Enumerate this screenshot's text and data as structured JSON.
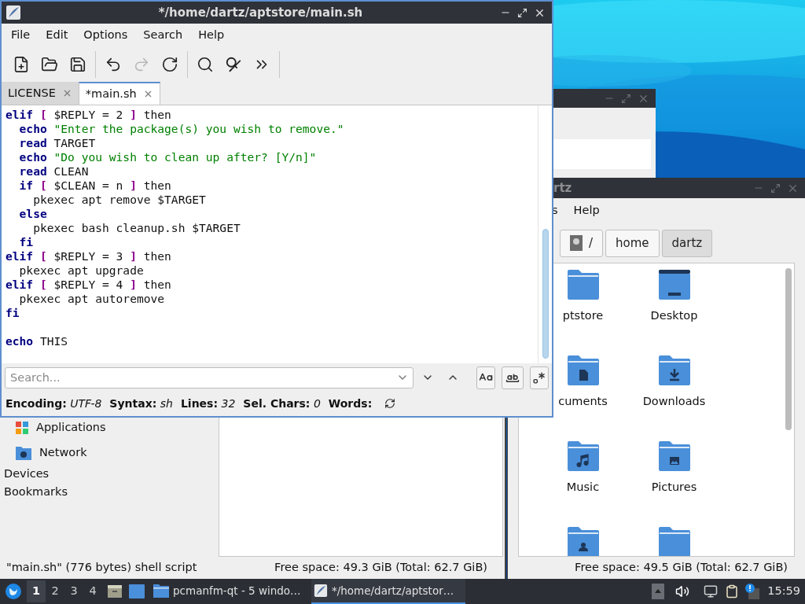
{
  "editor": {
    "title": "*/home/dartz/aptstore/main.sh",
    "menu": [
      "File",
      "Edit",
      "Options",
      "Search",
      "Help"
    ],
    "toolbar": [
      [
        {
          "disabled": false
        },
        {
          "disabled": false
        },
        {
          "disabled": false
        }
      ],
      [
        {
          "disabled": false
        },
        {
          "disabled": true
        },
        {
          "disabled": false
        }
      ],
      [
        {
          "disabled": false
        },
        {
          "disabled": false
        },
        {
          "disabled": false
        }
      ]
    ],
    "tabs": [
      {
        "label": "LICENSE",
        "selected": false
      },
      {
        "label": "*main.sh",
        "selected": true
      }
    ],
    "code": [
      [
        {
          "kind": "kw",
          "text": "elif"
        },
        {
          "kind": "br",
          "text": " ["
        },
        {
          "kind": "txt",
          "text": " $REPLY = 2 "
        },
        {
          "kind": "br",
          "text": "]"
        },
        {
          "kind": "txt",
          "text": " then"
        }
      ],
      [
        {
          "kind": "kw",
          "text": "  echo"
        },
        {
          "kind": "str",
          "text": " \"Enter the package(s) you wish to remove.\""
        }
      ],
      [
        {
          "kind": "kw",
          "text": "  read"
        },
        {
          "kind": "txt",
          "text": " TARGET"
        }
      ],
      [
        {
          "kind": "kw",
          "text": "  echo"
        },
        {
          "kind": "str",
          "text": " \"Do you wish to clean up after? [Y/n]\""
        }
      ],
      [
        {
          "kind": "kw",
          "text": "  read"
        },
        {
          "kind": "txt",
          "text": " CLEAN"
        }
      ],
      [
        {
          "kind": "kw",
          "text": "  if"
        },
        {
          "kind": "br",
          "text": " ["
        },
        {
          "kind": "txt",
          "text": " $CLEAN = n "
        },
        {
          "kind": "br",
          "text": "]"
        },
        {
          "kind": "txt",
          "text": " then"
        }
      ],
      [
        {
          "kind": "txt",
          "text": "    pkexec apt remove $TARGET"
        }
      ],
      [
        {
          "kind": "kw",
          "text": "  else"
        }
      ],
      [
        {
          "kind": "txt",
          "text": "    pkexec bash cleanup.sh $TARGET"
        }
      ],
      [
        {
          "kind": "kw",
          "text": "  fi"
        }
      ],
      [
        {
          "kind": "kw",
          "text": "elif"
        },
        {
          "kind": "br",
          "text": " ["
        },
        {
          "kind": "txt",
          "text": " $REPLY = 3 "
        },
        {
          "kind": "br",
          "text": "]"
        },
        {
          "kind": "txt",
          "text": " then"
        }
      ],
      [
        {
          "kind": "txt",
          "text": "  pkexec apt upgrade"
        }
      ],
      [
        {
          "kind": "kw",
          "text": "elif"
        },
        {
          "kind": "br",
          "text": " ["
        },
        {
          "kind": "txt",
          "text": " $REPLY = 4 "
        },
        {
          "kind": "br",
          "text": "]"
        },
        {
          "kind": "txt",
          "text": " then"
        }
      ],
      [
        {
          "kind": "txt",
          "text": "  pkexec apt autoremove"
        }
      ],
      [
        {
          "kind": "kw",
          "text": "fi"
        },
        {
          "kind": "blank_line"
        }
      ],
      [
        {
          "kind": "kw",
          "text": "echo"
        },
        {
          "kind": "txt",
          "text": " THIS"
        }
      ]
    ],
    "search": {
      "placeholder": "Search..."
    },
    "status": [
      {
        "label": "Encoding:",
        "value": "UTF-8"
      },
      {
        "label": "Syntax:",
        "value": "sh"
      },
      {
        "label": "Lines:",
        "value": "32"
      },
      {
        "label": "Sel. Chars:",
        "value": "0"
      },
      {
        "label": "Words:"
      }
    ]
  },
  "file_manager_left": {
    "sidebar": [
      {
        "label": "Applications",
        "kind": "apps"
      },
      {
        "label": "Network",
        "kind": "network"
      },
      {
        "label": "Devices",
        "kind": "header"
      },
      {
        "label": "Bookmarks",
        "kind": "header"
      }
    ],
    "status": "\"main.sh\" (776 bytes) shell script",
    "free_space": "Free space: 49.3 GiB (Total: 62.7 GiB)"
  },
  "file_manager_right": {
    "title": "rtz",
    "menu": [
      "s",
      "Help"
    ],
    "path": [
      {
        "label": "/",
        "kind": "root",
        "selected": false
      },
      {
        "label": "home",
        "kind": "dir",
        "selected": false
      },
      {
        "label": "dartz",
        "kind": "dir",
        "selected": true
      }
    ],
    "items": [
      {
        "label": "ptstore",
        "kind": "folder"
      },
      {
        "label": "Desktop",
        "kind": "desktop"
      },
      {
        "label": "cuments",
        "kind": "documents"
      },
      {
        "label": "Downloads",
        "kind": "downloads"
      },
      {
        "label": "Music",
        "kind": "music"
      },
      {
        "label": "Pictures",
        "kind": "pictures"
      },
      {
        "kind": "public"
      },
      {
        "kind": "folder"
      }
    ],
    "free_space": "Free space: 49.5 GiB (Total: 62.7 GiB)"
  },
  "taskbar": {
    "workspaces": [
      {
        "label": "1",
        "selected": true
      },
      {
        "label": "2",
        "selected": false
      },
      {
        "label": "3",
        "selected": false
      },
      {
        "label": "4",
        "selected": false
      }
    ],
    "tasks": [
      {
        "label": "pcmanfm-qt - 5 windo…",
        "kind": "folder",
        "selected": false
      },
      {
        "label": "*/home/dartz/aptstor…",
        "kind": "editor",
        "selected": true
      }
    ],
    "clock": "15:59"
  }
}
